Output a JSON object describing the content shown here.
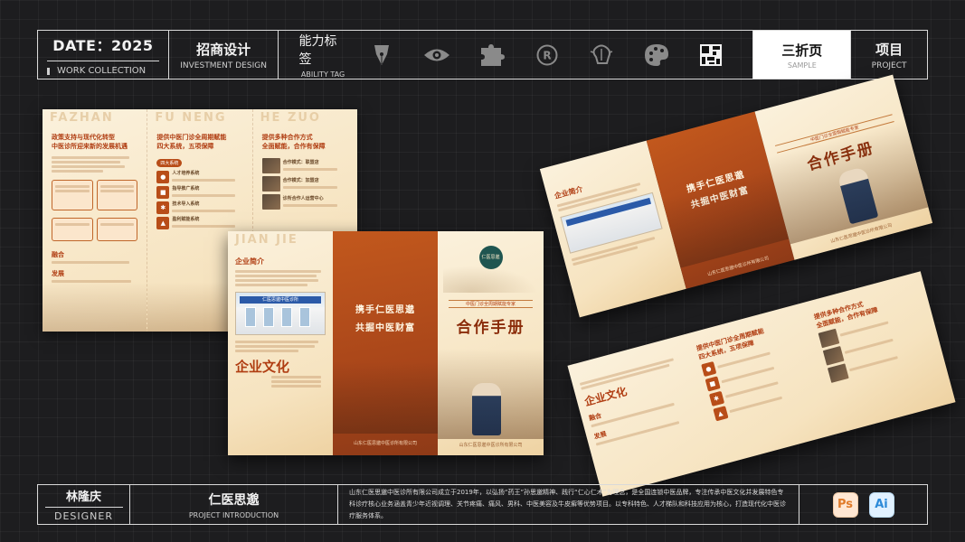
{
  "header": {
    "date_label": "DATE：2025",
    "work_collection": "WORK COLLECTION",
    "investment_title": "招商设计",
    "investment_sub": "INVESTMENT DESIGN",
    "ability_title": "能力标签",
    "ability_sub": "ABILITY TAG",
    "ability_icons": [
      "pen-nib-icon",
      "eye-icon",
      "puzzle-icon",
      "registered-icon",
      "brain-idea-icon",
      "palette-icon",
      "qr-pattern-icon"
    ],
    "trifold_title": "三折页",
    "trifold_sub": "SAMPLE",
    "project_title": "项目",
    "project_sub": "PROJECT"
  },
  "footer": {
    "designer_name": "林隆庆",
    "designer_label": "DESIGNER",
    "project_name": "仁医思邈",
    "project_label": "PROJECT INTRODUCTION",
    "description": "山东仁医思邈中医诊所有限公司成立于2019年，以弘扬“药王”孙思邈精神、践行“仁心仁术”为理念，是全国连锁中医品牌，专注传承中医文化并发展特色专科诊疗核心业务涵盖青少年近视调理、关节疼痛、痛风、男科、中医美容及牛皮癣等优势项目。以专科特色、人才梯队和科技应用为核心，打造现代化中医诊疗服务体系。",
    "apps": [
      "Ps",
      "Ai"
    ]
  },
  "brochure_inside": {
    "panel1": {
      "ghost": "FAZHAN",
      "title": "政策支持与现代化转型\n中医诊所迎来新的发展机遇",
      "sub1": "融合",
      "sub2": "发展"
    },
    "panel2": {
      "ghost": "FU NENG",
      "title": "提供中医门诊全周期赋能\n四大系统，五项保障",
      "items": [
        "人才培养系统",
        "指导推广系统",
        "技术导入系统",
        "盈利赋能系统"
      ]
    },
    "panel3": {
      "ghost": "HE ZUO",
      "title": "提供多种合作方式\n全面赋能，合作有保障",
      "items": [
        "合作模式：联盟店",
        "合作模式：加盟店",
        "诊所合作人运营中心"
      ]
    }
  },
  "brochure_cover": {
    "ghost": "JIAN JIE",
    "section_title": "企业简介",
    "building_sign": "仁医思邈中医诊所",
    "calligraphy": "企业文化",
    "slogan_line1": "携手仁医思邈",
    "slogan_line2": "共掘中医财富",
    "company_footer": "山东仁医思邈中医诊所有限公司",
    "logo_text": "仁医思邈",
    "band_text": "中医门诊全周期赋能专家",
    "cover_title": "合作手册"
  }
}
